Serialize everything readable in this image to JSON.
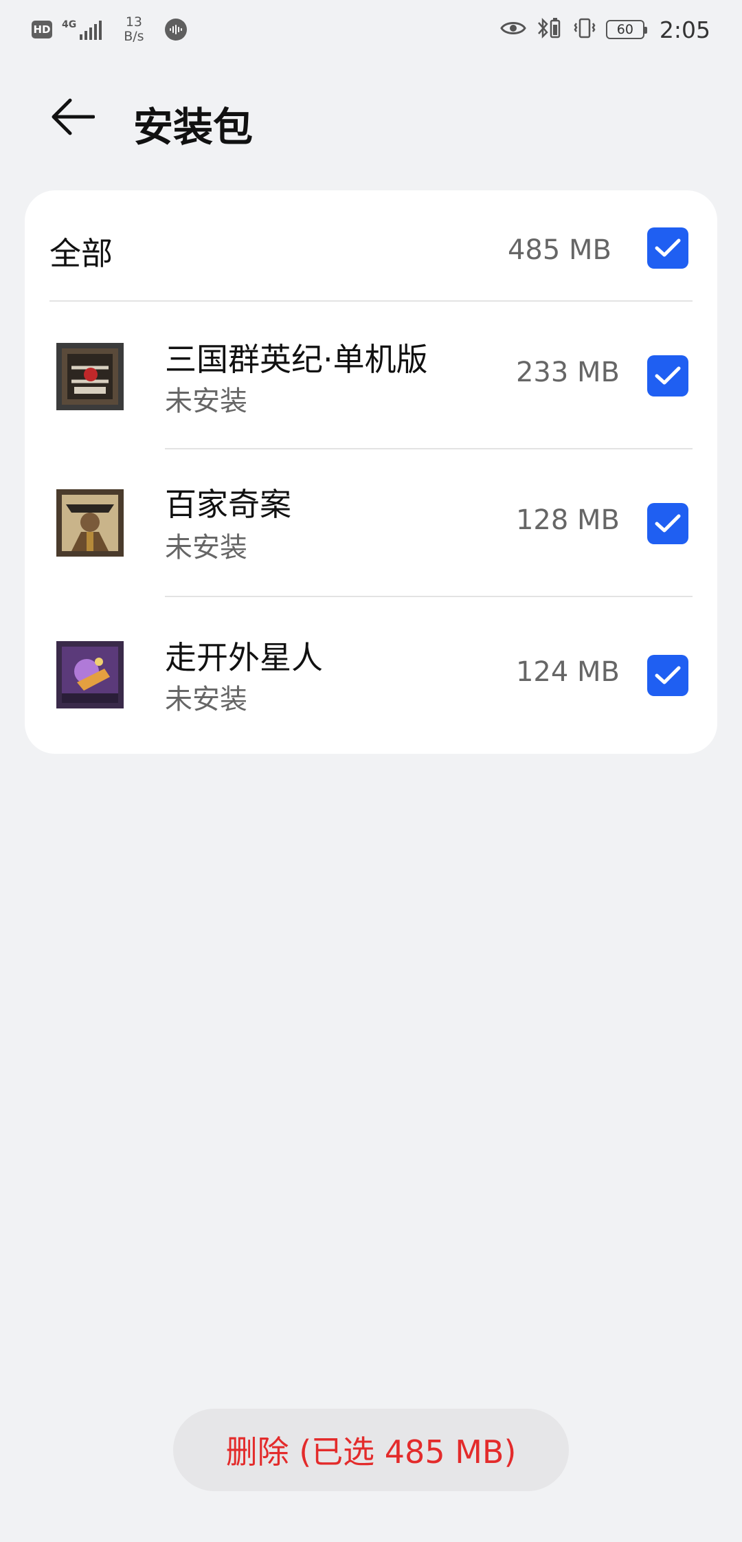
{
  "status_bar": {
    "hd_label": "HD",
    "network_label": "4G",
    "speed_value": "13",
    "speed_unit": "B/s",
    "battery": "60",
    "time": "2:05"
  },
  "header": {
    "title": "安装包"
  },
  "all_row": {
    "label": "全部",
    "size": "485 MB",
    "checked": true
  },
  "apps": [
    {
      "name": "三国群英纪·单机版",
      "status": "未安装",
      "size": "233 MB",
      "checked": true
    },
    {
      "name": "百家奇案",
      "status": "未安装",
      "size": "128 MB",
      "checked": true
    },
    {
      "name": "走开外星人",
      "status": "未安装",
      "size": "124 MB",
      "checked": true
    }
  ],
  "footer": {
    "delete_label": "删除 (已选 485 MB)"
  },
  "colors": {
    "accent": "#1f5ff2",
    "danger": "#e32b2b",
    "background": "#f1f2f4"
  }
}
